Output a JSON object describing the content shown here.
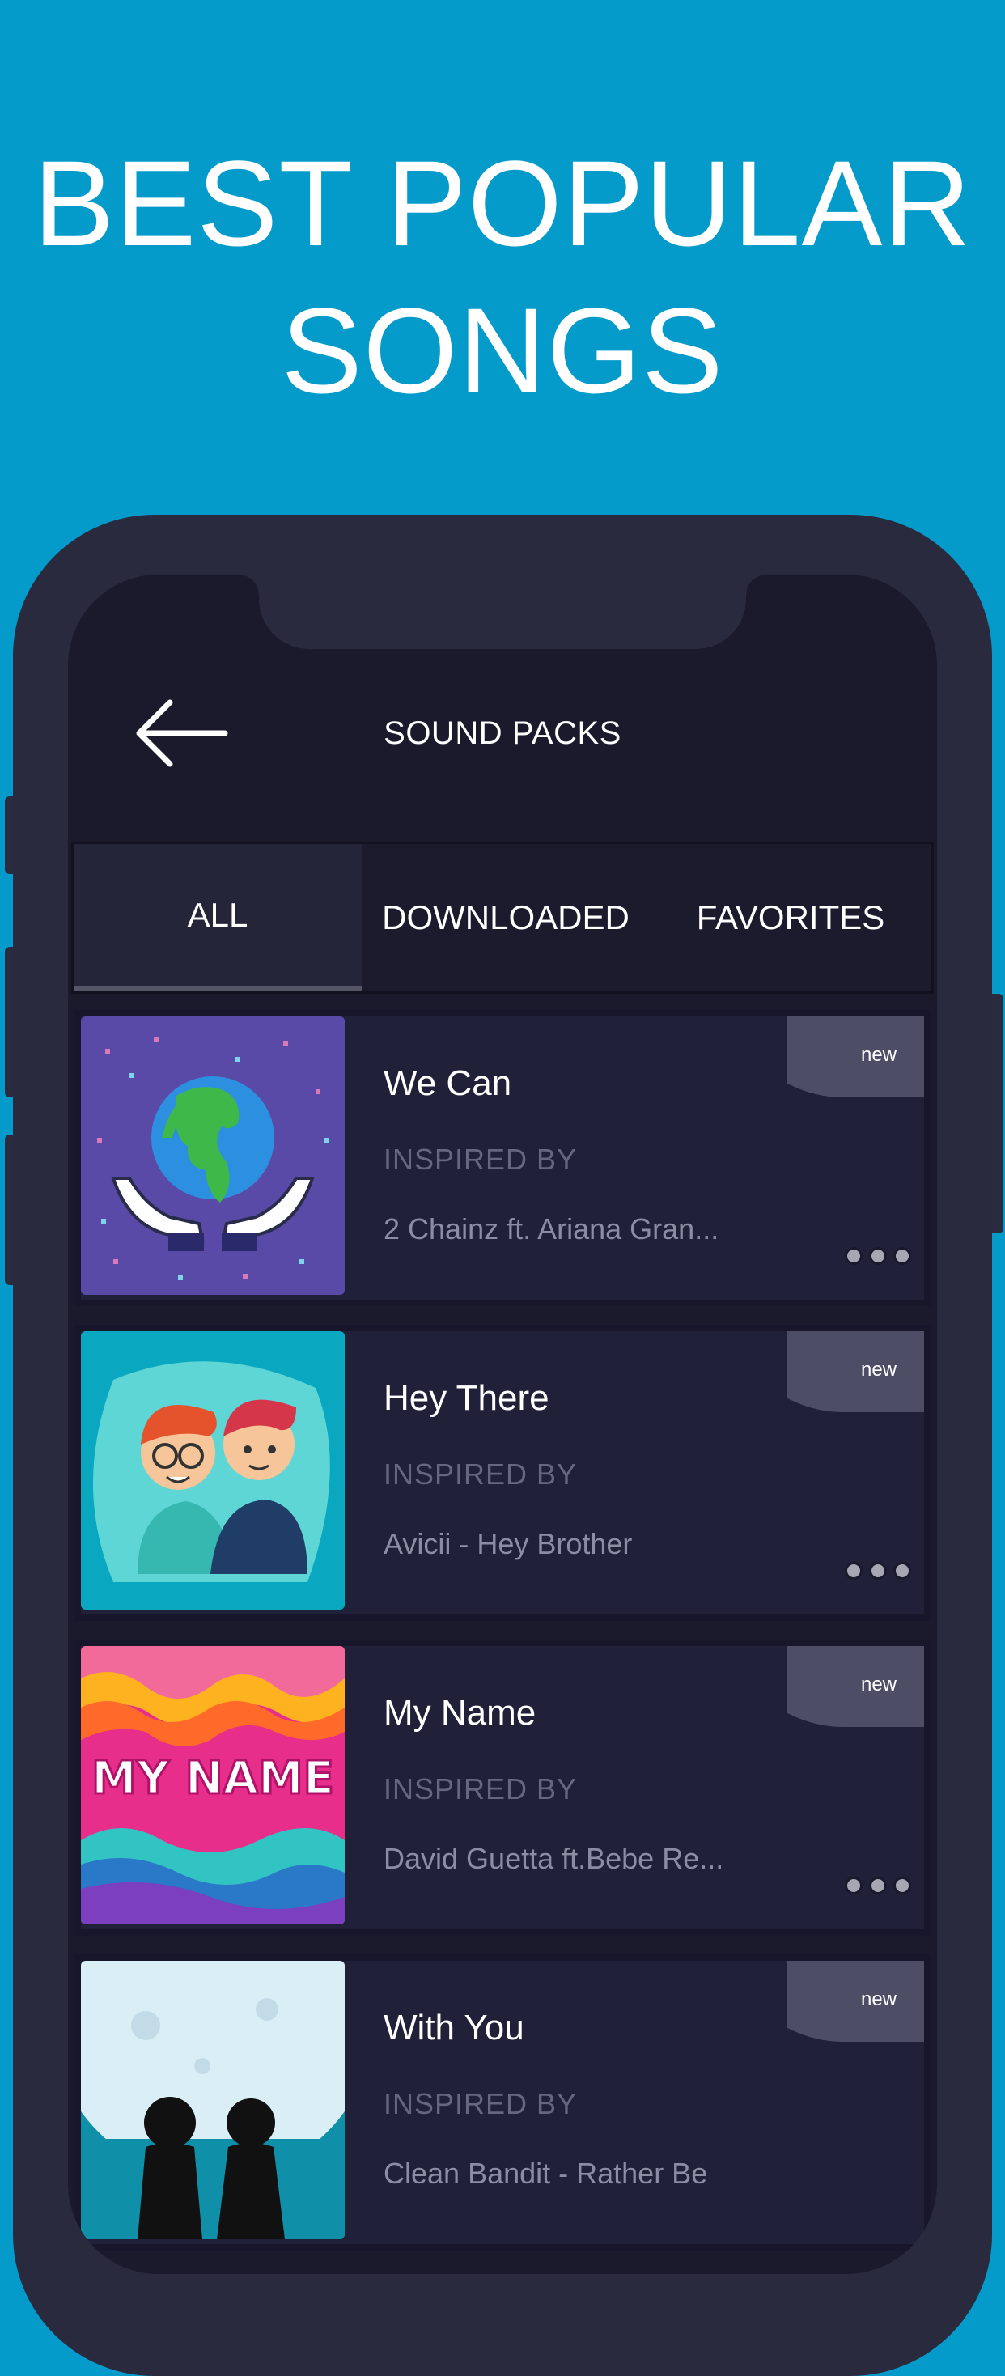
{
  "promo": {
    "headline_line1": "BEST POPULAR",
    "headline_line2": "SONGS"
  },
  "header": {
    "title": "SOUND PACKS",
    "back_icon": "arrow-left-icon"
  },
  "tabs": [
    {
      "label": "ALL",
      "active": true
    },
    {
      "label": "DOWNLOADED",
      "active": false
    },
    {
      "label": "FAVORITES",
      "active": false
    }
  ],
  "songs": [
    {
      "title": "We Can",
      "inspired_label": "INSPIRED BY",
      "artist": "2 Chainz ft. Ariana Gran...",
      "badge": "new",
      "art": "globe-hands-art"
    },
    {
      "title": "Hey There",
      "inspired_label": "INSPIRED BY",
      "artist": "Avicii - Hey Brother",
      "badge": "new",
      "art": "two-boys-art"
    },
    {
      "title": "My Name",
      "inspired_label": "INSPIRED BY",
      "artist": "David Guetta ft.Bebe Re...",
      "badge": "new",
      "art": "my-name-waves-art",
      "art_text": "MY NAME"
    },
    {
      "title": "With You",
      "inspired_label": "INSPIRED BY",
      "artist": "Clean Bandit - Rather Be",
      "badge": "new",
      "art": "moon-couple-art"
    }
  ],
  "colors": {
    "background": "#049bcb",
    "screen": "#1b1a2c",
    "card": "#202039",
    "badge": "#4d4e66"
  }
}
